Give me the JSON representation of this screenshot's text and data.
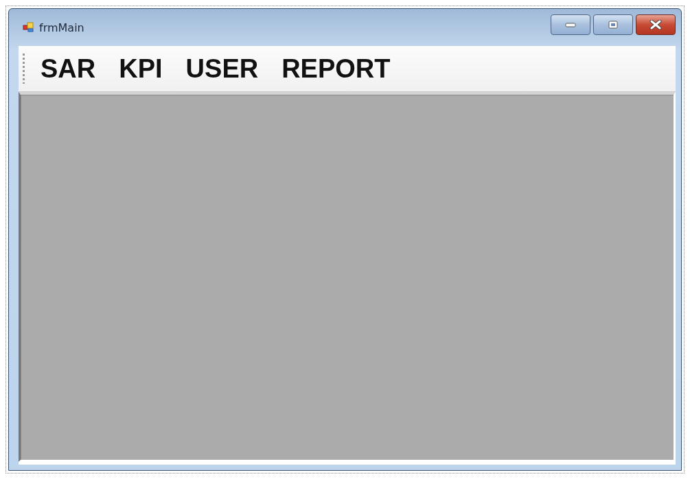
{
  "window": {
    "title": "frmMain"
  },
  "menu": [
    {
      "label": "SAR"
    },
    {
      "label": "KPI"
    },
    {
      "label": "USER"
    },
    {
      "label": "REPORT"
    }
  ]
}
